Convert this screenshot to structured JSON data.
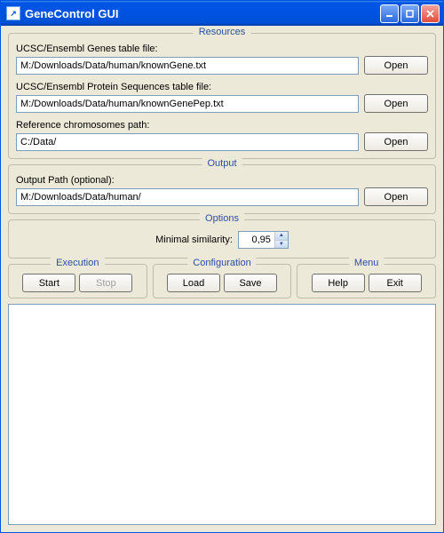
{
  "window": {
    "title": "GeneControl GUI"
  },
  "resources": {
    "title": "Resources",
    "genes_label": "UCSC/Ensembl Genes table file:",
    "genes_value": "M:/Downloads/Data/human/knownGene.txt",
    "protein_label": "UCSC/Ensembl Protein Sequences table file:",
    "protein_value": "M:/Downloads/Data/human/knownGenePep.txt",
    "chrom_label": "Reference chromosomes path:",
    "chrom_value": "C:/Data/",
    "open_label": "Open"
  },
  "output": {
    "title": "Output",
    "path_label": "Output Path (optional):",
    "path_value": "M:/Downloads/Data/human/",
    "open_label": "Open"
  },
  "options": {
    "title": "Options",
    "minsim_label": "Minimal similarity:",
    "minsim_value": "0,95"
  },
  "execution": {
    "title": "Execution",
    "start_label": "Start",
    "stop_label": "Stop"
  },
  "configuration": {
    "title": "Configuration",
    "load_label": "Load",
    "save_label": "Save"
  },
  "menu": {
    "title": "Menu",
    "help_label": "Help",
    "exit_label": "Exit"
  }
}
